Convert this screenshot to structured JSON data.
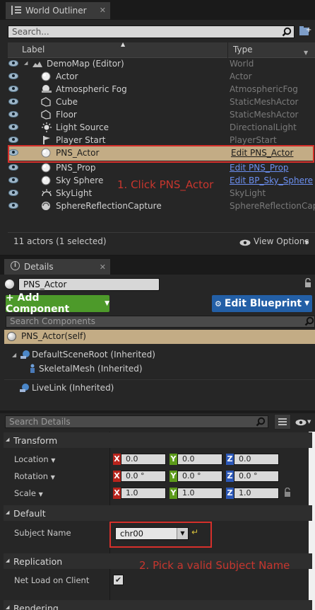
{
  "outliner": {
    "tab_title": "World Outliner",
    "search_placeholder": "Search...",
    "col_label": "Label",
    "col_type": "Type",
    "rows": [
      {
        "label": "DemoMap (Editor)",
        "type": "World",
        "type_link": false,
        "icon": "world-icon"
      },
      {
        "label": "Actor",
        "type": "Actor",
        "type_link": false,
        "icon": "actor-sphere-icon"
      },
      {
        "label": "Atmospheric Fog",
        "type": "AtmosphericFog",
        "type_link": false,
        "icon": "fog-icon"
      },
      {
        "label": "Cube",
        "type": "StaticMeshActor",
        "type_link": false,
        "icon": "static-mesh-icon"
      },
      {
        "label": "Floor",
        "type": "StaticMeshActor",
        "type_link": false,
        "icon": "static-mesh-icon"
      },
      {
        "label": "Light Source",
        "type": "DirectionalLight",
        "type_link": false,
        "icon": "directional-light-icon"
      },
      {
        "label": "Player Start",
        "type": "PlayerStart",
        "type_link": false,
        "icon": "player-start-icon"
      },
      {
        "label": "PNS_Actor",
        "type": "Edit PNS_Actor",
        "type_link": true,
        "selected": true,
        "icon": "actor-sphere-icon"
      },
      {
        "label": "PNS_Prop",
        "type": "Edit PNS_Prop",
        "type_link": true,
        "icon": "actor-sphere-icon"
      },
      {
        "label": "Sky Sphere",
        "type": "Edit BP_Sky_Sphere",
        "type_link": true,
        "icon": "actor-sphere-icon"
      },
      {
        "label": "SkyLight",
        "type": "SkyLight",
        "type_link": false,
        "icon": "skylight-icon"
      },
      {
        "label": "SphereReflectionCapture",
        "type": "SphereReflectionCapture",
        "type_link": false,
        "icon": "reflection-capture-icon"
      }
    ],
    "status": "11 actors (1 selected)",
    "view_options": "View Options"
  },
  "annotations": {
    "step1": "1. Click PNS_Actor",
    "step2": "2. Pick a valid Subject Name"
  },
  "details": {
    "tab_title": "Details",
    "actor_name": "PNS_Actor",
    "add_component": "+ Add Component",
    "edit_blueprint": "Edit Blueprint",
    "search_components_placeholder": "Search Components",
    "components": {
      "self": "PNS_Actor(self)",
      "root": "DefaultSceneRoot (Inherited)",
      "mesh": "SkeletalMesh (Inherited)",
      "livelink": "LiveLink (Inherited)"
    },
    "search_details_placeholder": "Search Details",
    "sections": {
      "transform": "Transform",
      "default": "Default",
      "replication": "Replication",
      "rendering": "Rendering"
    },
    "transform": {
      "location": {
        "label": "Location",
        "x": "0.0",
        "y": "0.0",
        "z": "0.0"
      },
      "rotation": {
        "label": "Rotation",
        "x": "0.0 °",
        "y": "0.0 °",
        "z": "0.0 °"
      },
      "scale": {
        "label": "Scale",
        "x": "1.0",
        "y": "1.0",
        "z": "1.0"
      },
      "axis_x": "X",
      "axis_y": "Y",
      "axis_z": "Z"
    },
    "subject_name": {
      "label": "Subject Name",
      "value": "chr00"
    },
    "net_load": {
      "label": "Net Load on Client",
      "checked": true
    }
  },
  "colors": {
    "selection": "#c3ac85",
    "annotation_red": "#c7362e",
    "add_component_green": "#4d9a2a",
    "edit_blueprint_blue": "#235fa6"
  }
}
